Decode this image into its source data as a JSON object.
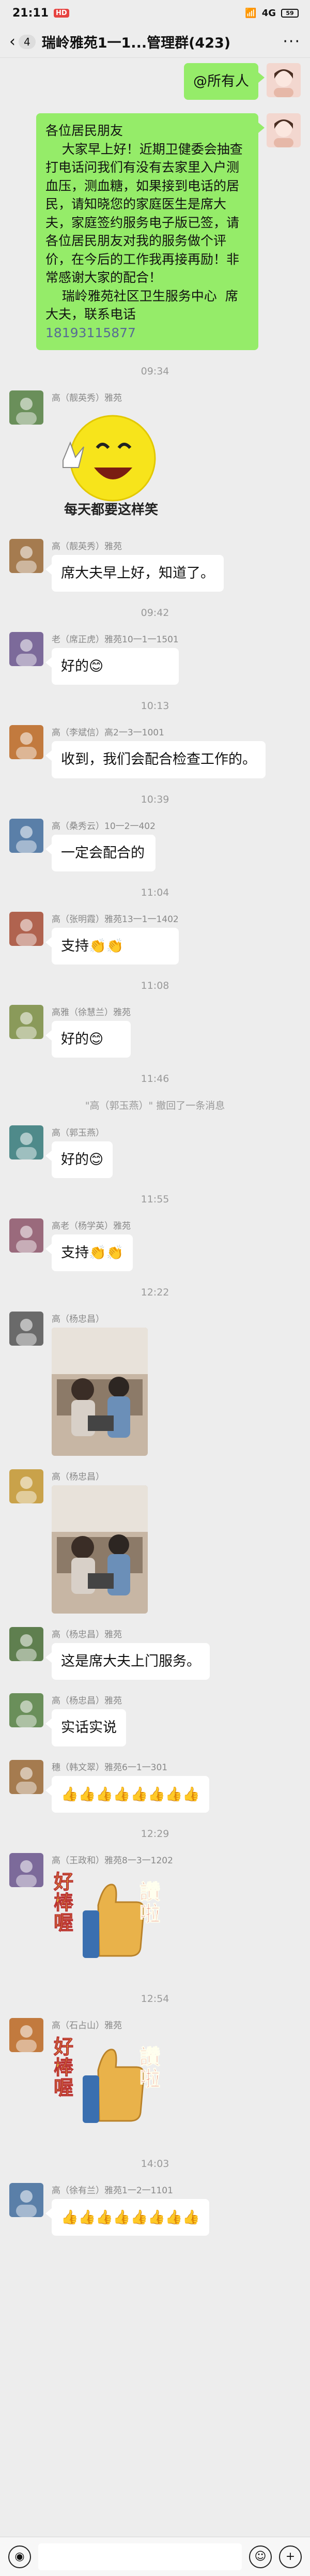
{
  "status_bar": {
    "time": "21:11",
    "notif_badge": "HD",
    "signal": "4G",
    "battery": "59"
  },
  "nav": {
    "back": "‹",
    "unread": "4",
    "title": "瑞岭雅苑1一1...管理群(423)",
    "more": "···"
  },
  "messages": [
    {
      "type": "out",
      "id": "m1",
      "text": "@所有人"
    },
    {
      "type": "out-long",
      "id": "m2",
      "lines": [
        "各位居民朋友",
        "    大家早上好！近期卫健委会抽查打电话问我们有没有去家里入户测血压，测血糖，如果接到电话的居民，请知晓您的家庭医生是席大夫，家庭签约服务电子版已签，请各位居民朋友对我的服务做个评价，在今后的工作我再接再励！非常感谢大家的配合！",
        "    瑞岭雅苑社区卫生服务中心  席大夫，联系电话"
      ],
      "phone": "18193115877"
    },
    {
      "type": "ts",
      "id": "t1",
      "text": "09:34"
    },
    {
      "type": "in-img",
      "id": "m3",
      "sender": "高（靓英秀）雅苑",
      "caption": "每天都要这样笑"
    },
    {
      "type": "in",
      "id": "m4",
      "sender": "高（靓英秀）雅苑",
      "text": "席大夫早上好，知道了。"
    },
    {
      "type": "ts",
      "id": "t2",
      "text": "09:42"
    },
    {
      "type": "in",
      "id": "m5",
      "sender": "老（席正虎）雅苑10一1一1501",
      "text": "好的😊"
    },
    {
      "type": "ts",
      "id": "t3",
      "text": "10:13"
    },
    {
      "type": "in",
      "id": "m6",
      "sender": "高（李斌信）高2一3一1001",
      "text": "收到，我们会配合检查工作的。"
    },
    {
      "type": "ts",
      "id": "t4",
      "text": "10:39"
    },
    {
      "type": "in",
      "id": "m7",
      "sender": "高（桑秀云）10一2一402",
      "text": "一定会配合的"
    },
    {
      "type": "ts",
      "id": "t5",
      "text": "11:04"
    },
    {
      "type": "in",
      "id": "m8",
      "sender": "高（张明霞）雅苑13一1一1402",
      "text": "支持👏👏"
    },
    {
      "type": "ts",
      "id": "t6",
      "text": "11:08"
    },
    {
      "type": "in",
      "id": "m9",
      "sender": "高雅（徐慧兰）雅苑",
      "text": "好的😊"
    },
    {
      "type": "ts",
      "id": "t7",
      "text": "11:46"
    },
    {
      "type": "sys",
      "id": "s1",
      "text": "\"高（郭玉燕）\" 撤回了一条消息"
    },
    {
      "type": "in",
      "id": "m10",
      "sender": "高（郭玉燕）",
      "text": "好的😊"
    },
    {
      "type": "ts",
      "id": "t8",
      "text": "11:55"
    },
    {
      "type": "in",
      "id": "m11",
      "sender": "高老（杨学英）雅苑",
      "text": "支持👏👏"
    },
    {
      "type": "ts",
      "id": "t9",
      "text": "12:22"
    },
    {
      "type": "in-photo",
      "id": "m12",
      "sender": "高（杨忠昌）"
    },
    {
      "type": "in-photo",
      "id": "m13",
      "sender": "高（杨忠昌）"
    },
    {
      "type": "in",
      "id": "m14",
      "sender": "高（杨忠昌）雅苑",
      "text": "这是席大夫上门服务。"
    },
    {
      "type": "in",
      "id": "m15",
      "sender": "高（杨忠昌）雅苑",
      "text": "实话实说"
    },
    {
      "type": "in",
      "id": "m16",
      "sender": "穗（韩文翠）雅苑6一1一301",
      "text": "👍👍👍👍👍👍👍👍"
    },
    {
      "type": "ts",
      "id": "t10",
      "text": "12:29"
    },
    {
      "type": "in-sticker",
      "id": "m17",
      "sender": "高（王政和）雅苑8一3一1202",
      "sticker_left": "好棒喔",
      "sticker_right": "讚啦"
    },
    {
      "type": "ts",
      "id": "t11",
      "text": "12:54"
    },
    {
      "type": "in-sticker",
      "id": "m18",
      "sender": "高（石占山）雅苑",
      "sticker_left": "好棒喔",
      "sticker_right": "讚啦"
    },
    {
      "type": "ts",
      "id": "t12",
      "text": "14:03"
    },
    {
      "type": "in",
      "id": "m19",
      "sender": "高（徐有兰）雅苑1一2一1101",
      "text": "👍👍👍👍👍👍👍👍"
    }
  ]
}
